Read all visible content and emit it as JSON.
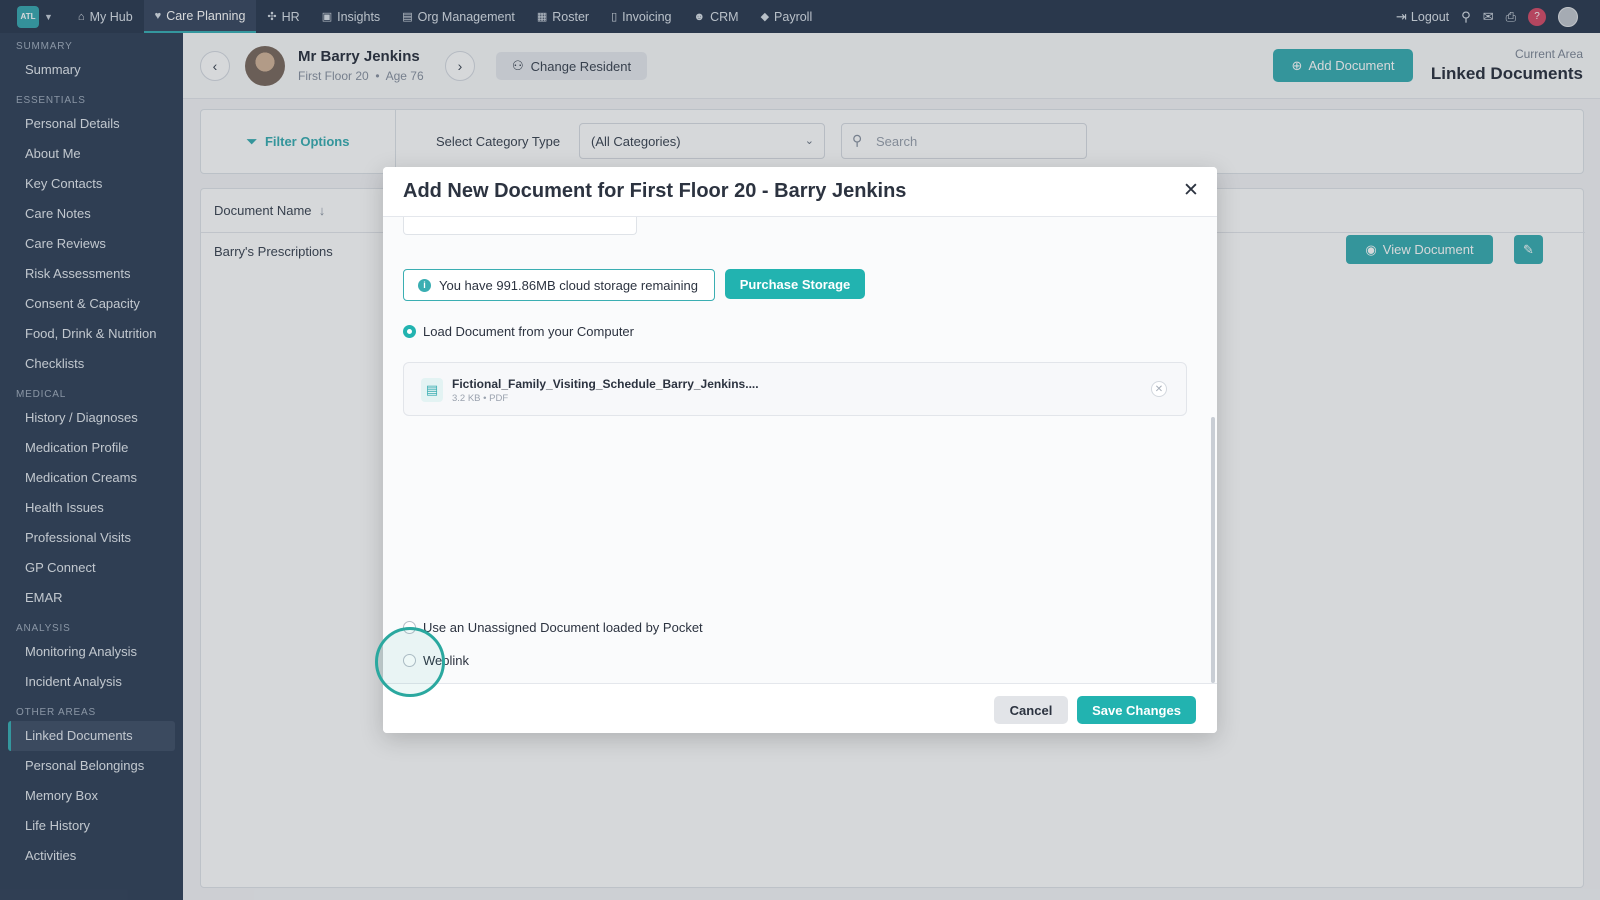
{
  "topnav": {
    "brand": "ATL",
    "items": [
      {
        "label": "My Hub",
        "icon": "home-icon",
        "glyph": "⌂"
      },
      {
        "label": "Care Planning",
        "icon": "heart-icon",
        "glyph": "♥"
      },
      {
        "label": "HR",
        "icon": "people-icon",
        "glyph": "✣"
      },
      {
        "label": "Insights",
        "icon": "chart-icon",
        "glyph": "▣"
      },
      {
        "label": "Org Management",
        "icon": "building-icon",
        "glyph": "▤"
      },
      {
        "label": "Roster",
        "icon": "calendar-icon",
        "glyph": "▦"
      },
      {
        "label": "Invoicing",
        "icon": "file-icon",
        "glyph": "▯"
      },
      {
        "label": "CRM",
        "icon": "user-icon",
        "glyph": "☻"
      },
      {
        "label": "Payroll",
        "icon": "tag-icon",
        "glyph": "◆"
      }
    ],
    "logout": "Logout",
    "help": "?"
  },
  "sidebar": {
    "sections": [
      {
        "title": "Summary",
        "items": [
          "Summary"
        ]
      },
      {
        "title": "Essentials",
        "items": [
          "Personal Details",
          "About Me",
          "Key Contacts",
          "Care Notes",
          "Care Reviews",
          "Risk Assessments",
          "Consent & Capacity",
          "Food, Drink & Nutrition",
          "Checklists"
        ]
      },
      {
        "title": "Medical",
        "items": [
          "History / Diagnoses",
          "Medication Profile",
          "Medication Creams",
          "Health Issues",
          "Professional Visits",
          "GP Connect",
          "EMAR"
        ]
      },
      {
        "title": "Analysis",
        "items": [
          "Monitoring Analysis",
          "Incident Analysis"
        ]
      },
      {
        "title": "Other Areas",
        "items": [
          "Linked Documents",
          "Personal Belongings",
          "Memory Box",
          "Life History",
          "Activities"
        ]
      }
    ],
    "active": "Linked Documents"
  },
  "resident": {
    "name": "Mr Barry Jenkins",
    "location": "First Floor 20",
    "age": "Age 76",
    "change_label": "Change Resident"
  },
  "header": {
    "add_document": "Add Document",
    "current_area_label": "Current Area",
    "current_area": "Linked Documents"
  },
  "filters": {
    "filter_options": "Filter Options",
    "category_label": "Select Category Type",
    "category_value": "(All Categories)",
    "search_placeholder": "Search"
  },
  "table": {
    "col_document_name": "Document Name",
    "rows": [
      {
        "name": "Barry's Prescriptions"
      }
    ],
    "view_label": "View Document"
  },
  "modal": {
    "title": "Add New Document for First Floor 20 - Barry Jenkins",
    "storage_note": "You have 991.86MB cloud storage remaining",
    "purchase_label": "Purchase Storage",
    "option_computer": "Load Document from your Computer",
    "file_name": "Fictional_Family_Visiting_Schedule_Barry_Jenkins....",
    "file_meta": "3.2 KB • PDF",
    "option_unassigned": "Use an Unassigned Document loaded by Pocket",
    "option_weblink": "Weblink",
    "selected_option": "computer",
    "cancel_label": "Cancel",
    "save_label": "Save Changes"
  },
  "colors": {
    "accent": "#22b3b0",
    "nav_bg": "#2e3c52",
    "sidebar_bg": "#34445b"
  }
}
